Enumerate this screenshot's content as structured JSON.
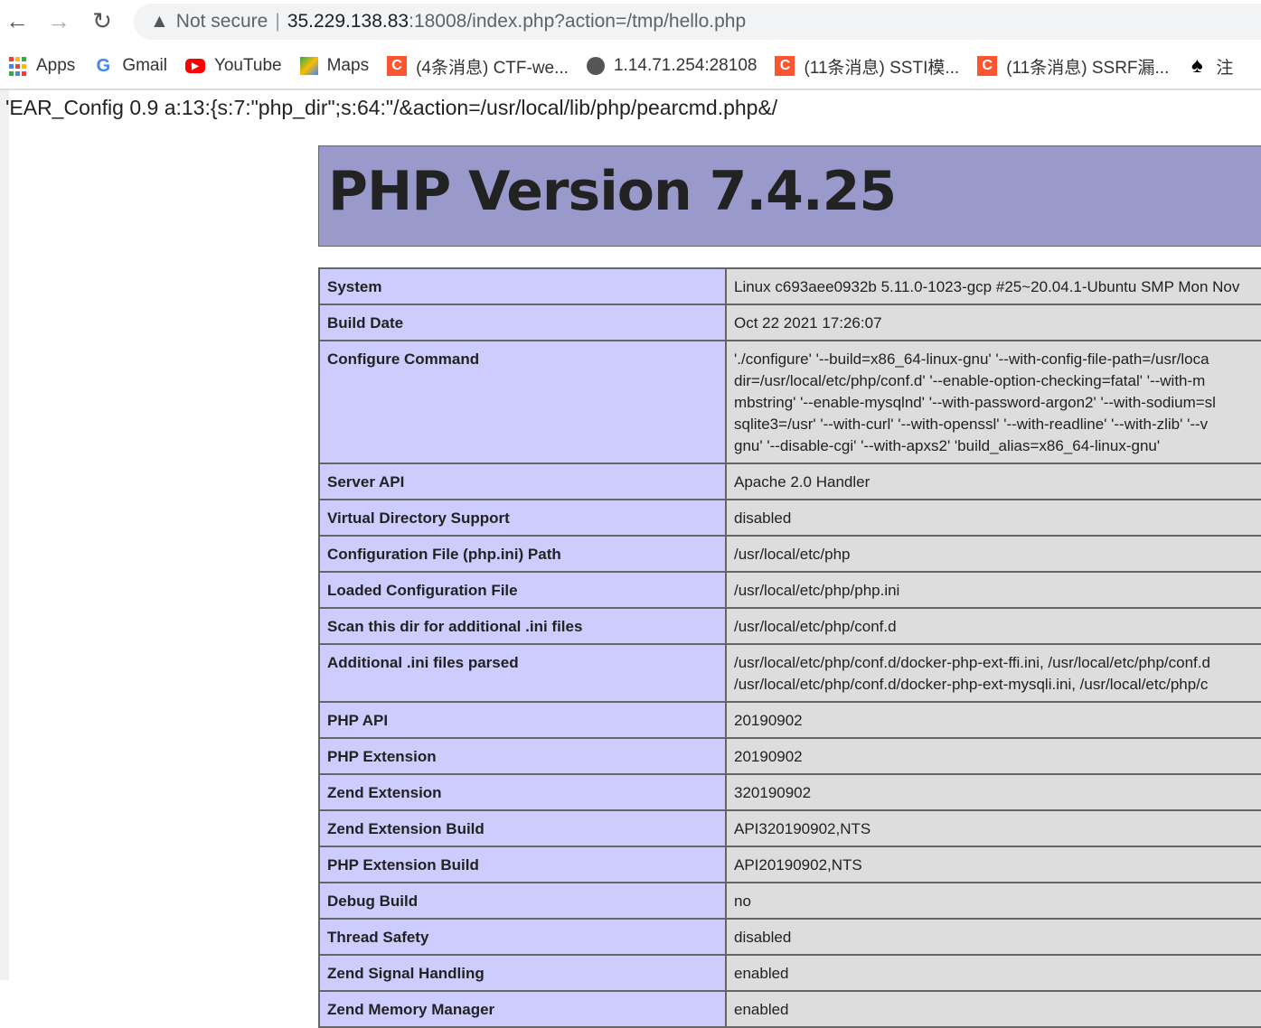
{
  "browser": {
    "url_security": "Not secure",
    "url_host": "35.229.138.83",
    "url_rest": ":18008/index.php?action=/tmp/hello.php",
    "bookmarks": [
      {
        "label": "Apps",
        "icon": "apps-icon"
      },
      {
        "label": "Gmail",
        "icon": "google-icon"
      },
      {
        "label": "YouTube",
        "icon": "youtube-icon"
      },
      {
        "label": "Maps",
        "icon": "maps-icon"
      },
      {
        "label": "(4条消息) CTF-we...",
        "icon": "csdn-icon"
      },
      {
        "label": "1.14.71.254:28108",
        "icon": "globe-icon"
      },
      {
        "label": "(11条消息) SSTI模...",
        "icon": "csdn-icon"
      },
      {
        "label": "(11条消息) SSRF漏...",
        "icon": "csdn-icon"
      },
      {
        "label": "注",
        "icon": "spade-icon"
      }
    ]
  },
  "page": {
    "echo_line": "'EAR_Config 0.9 a:13:{s:7:\"php_dir\";s:64:\"/&action=/usr/local/lib/php/pearcmd.php&/",
    "title": "PHP Version 7.4.25",
    "rows": [
      {
        "k": "System",
        "v": [
          "Linux c693aee0932b 5.11.0-1023-gcp #25~20.04.1-Ubuntu SMP Mon Nov"
        ]
      },
      {
        "k": "Build Date",
        "v": [
          "Oct 22 2021 17:26:07"
        ]
      },
      {
        "k": "Configure Command",
        "v": [
          "'./configure' '--build=x86_64-linux-gnu' '--with-config-file-path=/usr/loca",
          "dir=/usr/local/etc/php/conf.d' '--enable-option-checking=fatal' '--with-m",
          "mbstring' '--enable-mysqlnd' '--with-password-argon2' '--with-sodium=sl",
          "sqlite3=/usr' '--with-curl' '--with-openssl' '--with-readline' '--with-zlib' '--v",
          "gnu' '--disable-cgi' '--with-apxs2' 'build_alias=x86_64-linux-gnu'"
        ]
      },
      {
        "k": "Server API",
        "v": [
          "Apache 2.0 Handler"
        ]
      },
      {
        "k": "Virtual Directory Support",
        "v": [
          "disabled"
        ]
      },
      {
        "k": "Configuration File (php.ini) Path",
        "v": [
          "/usr/local/etc/php"
        ]
      },
      {
        "k": "Loaded Configuration File",
        "v": [
          "/usr/local/etc/php/php.ini"
        ]
      },
      {
        "k": "Scan this dir for additional .ini files",
        "v": [
          "/usr/local/etc/php/conf.d"
        ]
      },
      {
        "k": "Additional .ini files parsed",
        "v": [
          "/usr/local/etc/php/conf.d/docker-php-ext-ffi.ini, /usr/local/etc/php/conf.d",
          "/usr/local/etc/php/conf.d/docker-php-ext-mysqli.ini, /usr/local/etc/php/c"
        ]
      },
      {
        "k": "PHP API",
        "v": [
          "20190902"
        ]
      },
      {
        "k": "PHP Extension",
        "v": [
          "20190902"
        ]
      },
      {
        "k": "Zend Extension",
        "v": [
          "320190902"
        ]
      },
      {
        "k": "Zend Extension Build",
        "v": [
          "API320190902,NTS"
        ]
      },
      {
        "k": "PHP Extension Build",
        "v": [
          "API20190902,NTS"
        ]
      },
      {
        "k": "Debug Build",
        "v": [
          "no"
        ]
      },
      {
        "k": "Thread Safety",
        "v": [
          "disabled"
        ]
      },
      {
        "k": "Zend Signal Handling",
        "v": [
          "enabled"
        ]
      },
      {
        "k": "Zend Memory Manager",
        "v": [
          "enabled"
        ]
      }
    ]
  },
  "colors": {
    "header": "#9999cc",
    "label_cell": "#ccccff",
    "value_cell": "#dddddd",
    "csdn": "#fc5531"
  }
}
